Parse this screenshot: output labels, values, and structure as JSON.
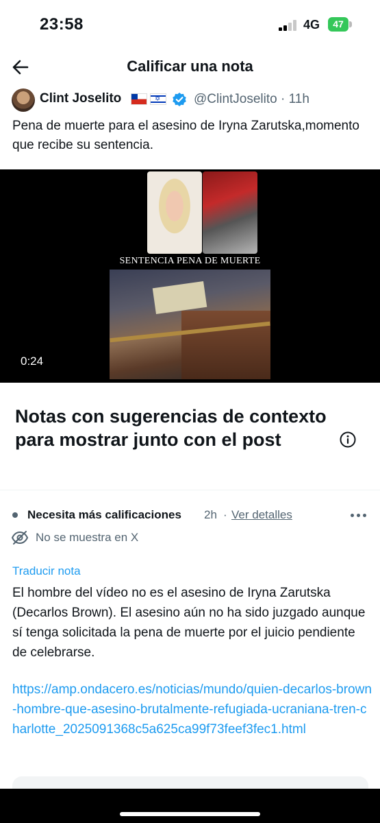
{
  "status_bar": {
    "time": "23:58",
    "network": "4G",
    "battery": "47"
  },
  "header": {
    "title": "Calificar una nota"
  },
  "post": {
    "author_name": "Clint Joselito",
    "handle_time": "@ClintJoselito · 11h",
    "text": "Pena de muerte para el asesino de Iryna Zarutska,momento que recibe su sentencia.",
    "video": {
      "caption": "SENTENCIA PENA DE MUERTE",
      "duration": "0:24"
    }
  },
  "notes": {
    "section_title": "Notas con sugerencias de contexto para mostrar junto con el post",
    "note": {
      "status": "Necesita más calificaciones",
      "time_ago": "2h",
      "separator": "·",
      "details_link": "Ver detalles",
      "visibility": "No se muestra en X",
      "translate": "Traducir nota",
      "text": "El hombre del vídeo no es el asesino de Iryna Zarutska (Decarlos Brown). El asesino aún no ha sido juzgado aunque sí tenga solicitada la pena de muerte por el juicio pendiente de celebrarse.",
      "url": "https://amp.ondacero.es/noticias/mundo/quien-decarlos-brown-hombre-que-asesino-brutalmente-refugiada-ucraniana-tren-charlotte_2025091368c5a625ca99f73feef3fec1.html"
    }
  },
  "colors": {
    "link": "#1d9bf0",
    "secondary_text": "#536471",
    "verified": "#1d9bf0",
    "battery": "#34c759"
  },
  "icons": [
    "back-arrow-icon",
    "verified-badge-icon",
    "info-icon",
    "more-icon",
    "eye-off-icon",
    "chile-flag-icon",
    "israel-flag-icon"
  ]
}
